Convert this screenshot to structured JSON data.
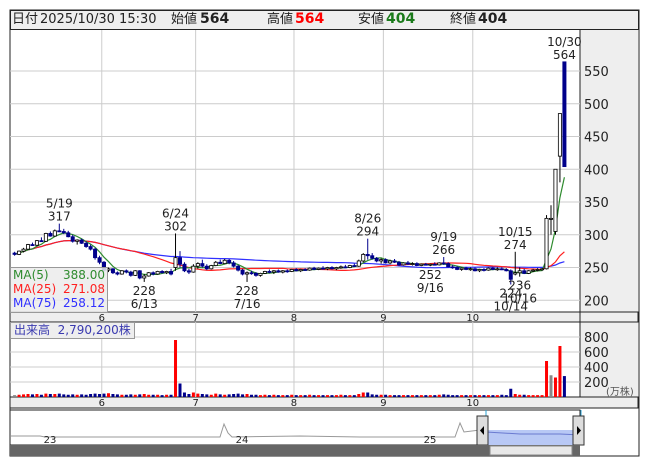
{
  "header": {
    "date_label": "日付",
    "date_value": "2025/10/30 15:30",
    "open_label": "始値",
    "open_value": "564",
    "high_label": "高値",
    "high_value": "564",
    "low_label": "安値",
    "low_value": "404",
    "close_label": "終値",
    "close_value": "404"
  },
  "ma_legend": [
    {
      "label": "MA(5)",
      "value": "388.00",
      "color": "#2e8b2e"
    },
    {
      "label": "MA(25)",
      "value": "271.08",
      "color": "#ff2020"
    },
    {
      "label": "MA(75)",
      "value": "258.12",
      "color": "#3030ff"
    }
  ],
  "volume_label": {
    "label": "出来高",
    "value": "2,790,200株"
  },
  "colors": {
    "up_candle": "#ffffff",
    "down_candle": "#00008b",
    "vol_up": "#ff0000",
    "vol_down": "#00008b",
    "vol_flat": "#888888",
    "price_label": "#8b4500"
  },
  "chart_data": {
    "type": "candlestick",
    "price_axis": {
      "ylim": [
        190,
        575
      ],
      "ticks": [
        200,
        250,
        300,
        350,
        400,
        450,
        500,
        550
      ]
    },
    "volume_axis": {
      "unit_label": "(万株)",
      "ylim": [
        0,
        900
      ],
      "ticks": [
        200,
        400,
        600,
        800
      ]
    },
    "x_month_labels": [
      {
        "label": "6",
        "start": "6/2"
      },
      {
        "label": "7",
        "start": "7/1"
      },
      {
        "label": "8",
        "start": "8/1"
      },
      {
        "label": "9",
        "start": "9/1"
      },
      {
        "label": "10",
        "start": "10/1"
      }
    ],
    "grid": true,
    "columns": [
      "date",
      "open",
      "high",
      "low",
      "close",
      "volume_万株"
    ],
    "candles": [
      [
        "5/1",
        272,
        274,
        268,
        270,
        25
      ],
      [
        "5/2",
        270,
        276,
        269,
        275,
        30
      ],
      [
        "5/7",
        275,
        280,
        273,
        278,
        35
      ],
      [
        "5/8",
        278,
        286,
        277,
        285,
        40
      ],
      [
        "5/9",
        285,
        288,
        283,
        284,
        35
      ],
      [
        "5/12",
        284,
        292,
        283,
        291,
        40
      ],
      [
        "5/13",
        291,
        296,
        289,
        290,
        30
      ],
      [
        "5/14",
        290,
        303,
        289,
        302,
        45
      ],
      [
        "5/15",
        302,
        305,
        297,
        298,
        40
      ],
      [
        "5/16",
        298,
        308,
        297,
        306,
        40
      ],
      [
        "5/19",
        306,
        317,
        304,
        305,
        45
      ],
      [
        "5/20",
        305,
        309,
        301,
        303,
        35
      ],
      [
        "5/21",
        303,
        306,
        296,
        297,
        30
      ],
      [
        "5/22",
        297,
        300,
        288,
        290,
        35
      ],
      [
        "5/23",
        290,
        293,
        285,
        292,
        30
      ],
      [
        "5/26",
        292,
        294,
        286,
        287,
        35
      ],
      [
        "5/27",
        287,
        290,
        280,
        282,
        30
      ],
      [
        "5/28",
        282,
        285,
        276,
        278,
        40
      ],
      [
        "5/29",
        278,
        280,
        262,
        265,
        45
      ],
      [
        "5/30",
        265,
        268,
        255,
        258,
        40
      ],
      [
        "6/2",
        258,
        260,
        244,
        246,
        45
      ],
      [
        "6/3",
        246,
        250,
        243,
        248,
        50
      ],
      [
        "6/4",
        248,
        249,
        240,
        242,
        40
      ],
      [
        "6/5",
        242,
        244,
        238,
        240,
        35
      ],
      [
        "6/6",
        240,
        246,
        239,
        245,
        30
      ],
      [
        "6/9",
        245,
        247,
        241,
        243,
        30
      ],
      [
        "6/10",
        243,
        245,
        236,
        238,
        35
      ],
      [
        "6/11",
        238,
        246,
        237,
        245,
        30
      ],
      [
        "6/12",
        245,
        246,
        232,
        234,
        35
      ],
      [
        "6/13",
        234,
        240,
        228,
        237,
        40
      ],
      [
        "6/16",
        237,
        243,
        236,
        242,
        30
      ],
      [
        "6/17",
        242,
        244,
        238,
        240,
        30
      ],
      [
        "6/18",
        240,
        245,
        239,
        244,
        30
      ],
      [
        "6/19",
        244,
        246,
        241,
        242,
        25
      ],
      [
        "6/20",
        242,
        245,
        240,
        244,
        30
      ],
      [
        "6/23",
        244,
        248,
        238,
        240,
        30
      ],
      [
        "6/24",
        250,
        302,
        245,
        265,
        760
      ],
      [
        "6/25",
        265,
        275,
        250,
        255,
        180
      ],
      [
        "6/26",
        255,
        258,
        243,
        245,
        60
      ],
      [
        "6/27",
        245,
        248,
        240,
        243,
        40
      ],
      [
        "6/30",
        243,
        255,
        242,
        252,
        60
      ],
      [
        "7/1",
        252,
        258,
        248,
        256,
        45
      ],
      [
        "7/2",
        256,
        262,
        250,
        252,
        40
      ],
      [
        "7/3",
        252,
        255,
        246,
        248,
        35
      ],
      [
        "7/4",
        248,
        254,
        247,
        253,
        30
      ],
      [
        "7/7",
        253,
        260,
        252,
        258,
        45
      ],
      [
        "7/8",
        258,
        262,
        255,
        256,
        35
      ],
      [
        "7/9",
        256,
        263,
        255,
        261,
        30
      ],
      [
        "7/10",
        261,
        263,
        255,
        257,
        35
      ],
      [
        "7/11",
        257,
        260,
        250,
        252,
        40
      ],
      [
        "7/14",
        252,
        254,
        244,
        246,
        45
      ],
      [
        "7/15",
        246,
        248,
        238,
        240,
        35
      ],
      [
        "7/16",
        240,
        244,
        228,
        242,
        40
      ],
      [
        "7/17",
        242,
        245,
        239,
        241,
        30
      ],
      [
        "7/18",
        241,
        243,
        236,
        238,
        30
      ],
      [
        "7/22",
        238,
        242,
        236,
        241,
        25
      ],
      [
        "7/23",
        241,
        245,
        240,
        244,
        30
      ],
      [
        "7/24",
        244,
        247,
        241,
        243,
        25
      ],
      [
        "7/25",
        243,
        246,
        240,
        245,
        30
      ],
      [
        "7/28",
        245,
        247,
        242,
        243,
        25
      ],
      [
        "7/29",
        243,
        246,
        241,
        245,
        25
      ],
      [
        "7/30",
        245,
        247,
        242,
        244,
        25
      ],
      [
        "7/31",
        244,
        248,
        243,
        247,
        30
      ],
      [
        "8/1",
        247,
        249,
        244,
        245,
        25
      ],
      [
        "8/4",
        245,
        248,
        243,
        247,
        25
      ],
      [
        "8/5",
        247,
        249,
        245,
        246,
        25
      ],
      [
        "8/6",
        246,
        250,
        245,
        249,
        30
      ],
      [
        "8/7",
        249,
        251,
        246,
        247,
        25
      ],
      [
        "8/8",
        247,
        250,
        246,
        249,
        25
      ],
      [
        "8/12",
        249,
        252,
        247,
        248,
        25
      ],
      [
        "8/13",
        248,
        251,
        246,
        250,
        25
      ],
      [
        "8/14",
        250,
        252,
        247,
        248,
        25
      ],
      [
        "8/15",
        248,
        251,
        246,
        250,
        25
      ],
      [
        "8/18",
        250,
        253,
        248,
        251,
        30
      ],
      [
        "8/19",
        251,
        254,
        249,
        250,
        25
      ],
      [
        "8/20",
        250,
        254,
        249,
        253,
        25
      ],
      [
        "8/21",
        253,
        256,
        251,
        252,
        25
      ],
      [
        "8/22",
        252,
        262,
        251,
        260,
        40
      ],
      [
        "8/25",
        260,
        272,
        258,
        270,
        60
      ],
      [
        "8/26",
        270,
        294,
        262,
        268,
        60
      ],
      [
        "8/27",
        268,
        272,
        262,
        264,
        35
      ],
      [
        "8/28",
        264,
        266,
        258,
        260,
        30
      ],
      [
        "8/29",
        260,
        264,
        256,
        262,
        30
      ],
      [
        "9/1",
        262,
        264,
        256,
        257,
        30
      ],
      [
        "9/2",
        257,
        262,
        255,
        260,
        25
      ],
      [
        "9/3",
        260,
        263,
        257,
        258,
        25
      ],
      [
        "9/4",
        258,
        260,
        252,
        254,
        25
      ],
      [
        "9/5",
        254,
        258,
        253,
        257,
        25
      ],
      [
        "9/8",
        257,
        260,
        254,
        255,
        25
      ],
      [
        "9/9",
        255,
        258,
        253,
        256,
        25
      ],
      [
        "9/10",
        256,
        258,
        252,
        253,
        25
      ],
      [
        "9/11",
        253,
        256,
        252,
        255,
        25
      ],
      [
        "9/12",
        255,
        257,
        253,
        254,
        25
      ],
      [
        "9/16",
        254,
        256,
        252,
        255,
        25
      ],
      [
        "9/17",
        255,
        258,
        253,
        254,
        25
      ],
      [
        "9/18",
        254,
        258,
        253,
        257,
        30
      ],
      [
        "9/19",
        257,
        266,
        254,
        256,
        35
      ],
      [
        "9/22",
        256,
        258,
        250,
        251,
        30
      ],
      [
        "9/24",
        251,
        254,
        248,
        250,
        25
      ],
      [
        "9/25",
        250,
        252,
        246,
        247,
        25
      ],
      [
        "9/26",
        247,
        250,
        245,
        249,
        25
      ],
      [
        "9/29",
        249,
        251,
        246,
        247,
        25
      ],
      [
        "9/30",
        247,
        250,
        245,
        248,
        25
      ],
      [
        "10/1",
        248,
        250,
        244,
        245,
        25
      ],
      [
        "10/2",
        245,
        248,
        243,
        247,
        25
      ],
      [
        "10/3",
        247,
        249,
        244,
        246,
        25
      ],
      [
        "10/6",
        246,
        250,
        245,
        249,
        25
      ],
      [
        "10/7",
        249,
        251,
        246,
        247,
        25
      ],
      [
        "10/8",
        247,
        250,
        245,
        248,
        25
      ],
      [
        "10/9",
        248,
        250,
        246,
        247,
        30
      ],
      [
        "10/10",
        247,
        249,
        244,
        245,
        25
      ],
      [
        "10/14",
        245,
        247,
        224,
        232,
        110
      ],
      [
        "10/15",
        240,
        274,
        238,
        242,
        40
      ],
      [
        "10/16",
        242,
        250,
        236,
        245,
        30
      ],
      [
        "10/17",
        245,
        248,
        240,
        241,
        30
      ],
      [
        "10/20",
        241,
        246,
        240,
        245,
        25
      ],
      [
        "10/21",
        245,
        248,
        243,
        246,
        25
      ],
      [
        "10/22",
        246,
        249,
        244,
        247,
        25
      ],
      [
        "10/23",
        247,
        249,
        245,
        248,
        25
      ],
      [
        "10/24",
        248,
        330,
        247,
        325,
        480
      ],
      [
        "10/27",
        325,
        345,
        300,
        325,
        290
      ],
      [
        "10/28",
        305,
        400,
        300,
        400,
        260
      ],
      [
        "10/29",
        420,
        485,
        380,
        485,
        680
      ],
      [
        "10/30",
        564,
        564,
        404,
        404,
        279.02
      ]
    ],
    "annotations": [
      {
        "date": "5/19",
        "value": "317",
        "position": "above"
      },
      {
        "date": "6/13",
        "value": "228",
        "position": "below"
      },
      {
        "date": "6/24",
        "value": "302",
        "position": "above"
      },
      {
        "date": "7/16",
        "value": "228",
        "position": "below"
      },
      {
        "date": "8/26",
        "value": "294",
        "position": "above"
      },
      {
        "date": "9/16",
        "value": "252",
        "position": "below"
      },
      {
        "date": "9/19",
        "value": "266",
        "position": "above"
      },
      {
        "date": "10/14",
        "value": "224",
        "position": "below"
      },
      {
        "date": "10/15",
        "value": "274",
        "position": "above"
      },
      {
        "date": "10/16",
        "value": "236",
        "position": "below"
      },
      {
        "date": "10/30",
        "value": "564",
        "position": "above"
      }
    ],
    "moving_averages": [
      5,
      25,
      75
    ]
  },
  "navigator": {
    "year_labels": [
      "23",
      "24",
      "25"
    ]
  }
}
